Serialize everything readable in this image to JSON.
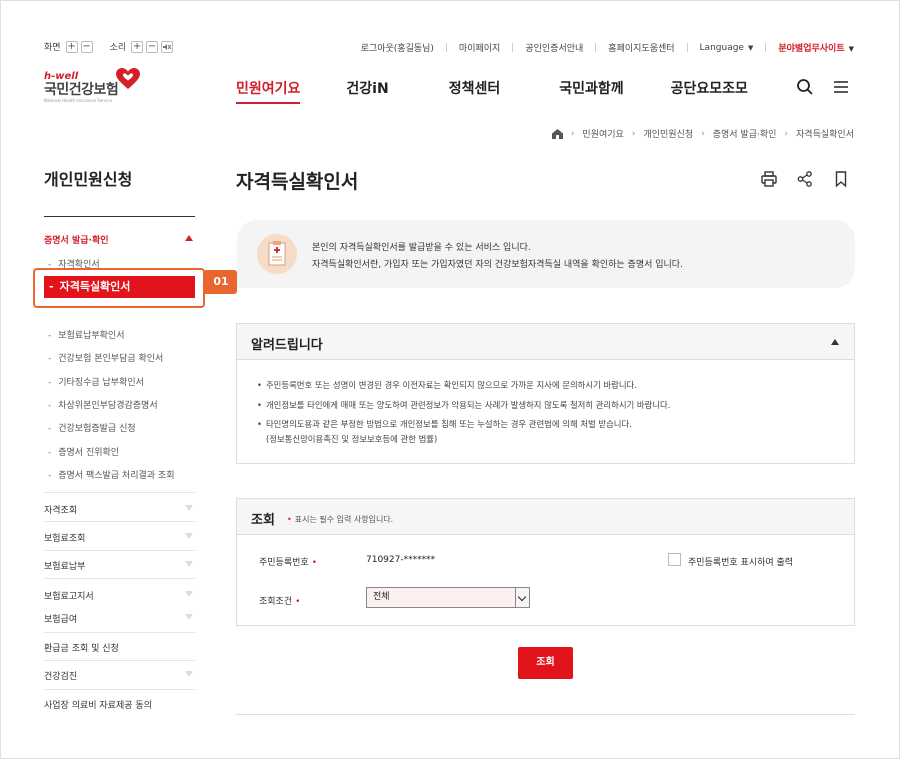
{
  "util_left": {
    "screen_label": "화면",
    "sound_label": "소리",
    "plus": "+",
    "minus": "−"
  },
  "util_right": {
    "links": [
      "로그아웃(홍길동님)",
      "마이페이지",
      "공인인증서안내",
      "홈페이지도움센터"
    ],
    "language": "Language",
    "department_sites": "분야별업무사이트"
  },
  "logo": {
    "hwell": "h-well",
    "name": "국민건강보험",
    "sub": "National Health Insurance Service"
  },
  "gnb": [
    "민원여기요",
    "건강iN",
    "정책센터",
    "국민과함께",
    "공단요모조모"
  ],
  "breadcrumb": [
    "민원여기요",
    "개인민원신청",
    "증명서 발급·확인",
    "자격득실확인서"
  ],
  "sidebar": {
    "title": "개인민원신청",
    "open_category": "증명서 발급·확인",
    "sub_items": [
      "자격확인서",
      "자격득실확인서",
      "보험료납부확인서",
      "건강보험 본인부담금 확인서",
      "기타징수금 납부확인서",
      "차상위본인부담경감증명서",
      "건강보험증발급 신청",
      "증명서 진위확인",
      "증명서 팩스발급 처리결과 조회"
    ],
    "highlight_tag": "01",
    "categories": [
      "자격조회",
      "보험료조회",
      "보험료납부",
      "보험료고지서",
      "보험급여",
      "환급금 조회 및 신청",
      "건강검진",
      "사업장 의료비 자료제공 동의"
    ]
  },
  "main": {
    "title": "자격득실확인서",
    "intro": [
      "본인의 자격득실확인서를 발급받을 수 있는 서비스 입니다.",
      "자격득실확인서란, 가입자 또는 가입자였던 자의 건강보험자격득실 내역을 확인하는 증명서 입니다."
    ],
    "notice": {
      "title": "알려드립니다",
      "items": [
        "주민등록번호 또는 성명이 변경된 경우 이전자료는 확인되지 않으므로 가까운 지사에 문의하시기 바랍니다.",
        "개인정보를 타인에게 매매 또는 양도하여 관련정보가 악용되는 사례가 발생하지 않도록 철저히 관리하시기 바랍니다.",
        "타인명의도용과 같은 부정한 방법으로 개인정보를 침해 또는 누설하는 경우 관련법에 의해 처벌 받습니다."
      ],
      "item3_cont": "(정보통신망이용촉진 및 정보보호등에 관한 법률)"
    },
    "form": {
      "title": "조회",
      "required_note": "표시는 필수 입력 사항입니다.",
      "req_mark": "•",
      "rrn_label": "주민등록번호",
      "rrn_value": "710927-*******",
      "show_rrn_label": "주민등록번호 표시하여 출력",
      "cond_label": "조회조건",
      "cond_value": "전체"
    },
    "submit_label": "조회"
  },
  "colors": {
    "brand_red": "#d21f2a",
    "highlight_orange": "#e8662f",
    "button_red": "#e3131b"
  }
}
